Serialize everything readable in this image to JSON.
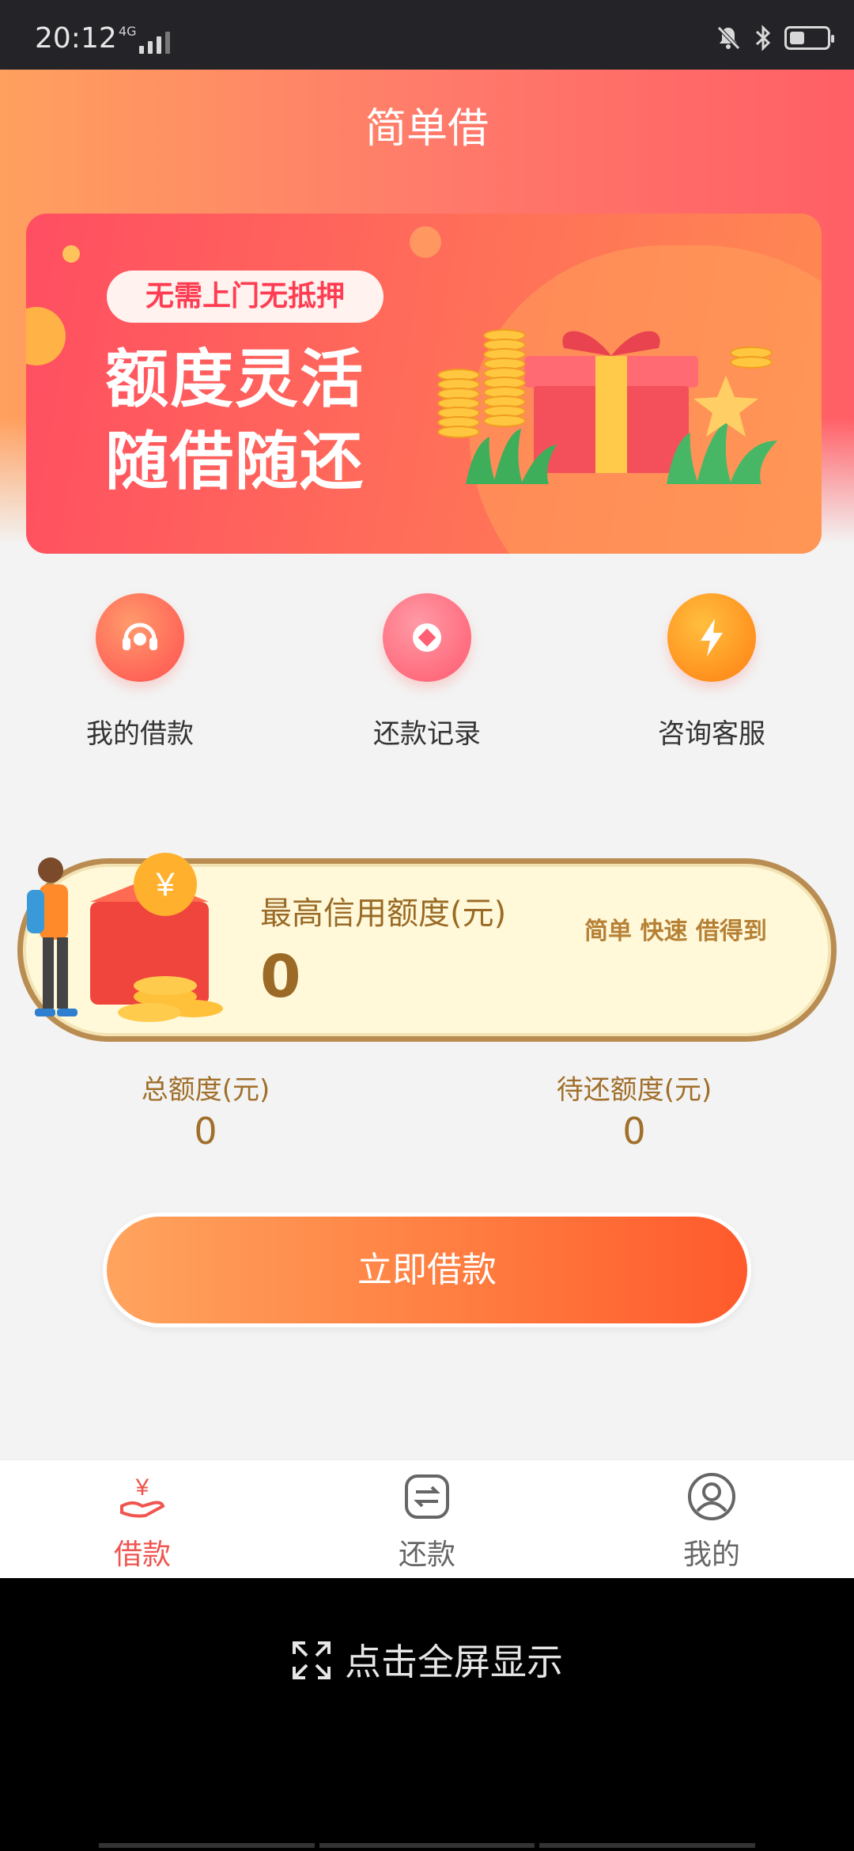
{
  "status_bar": {
    "time": "20:12",
    "network": "4G"
  },
  "header": {
    "title": "简单借"
  },
  "banner": {
    "tag": "无需上门无抵押",
    "headline_line1": "额度灵活",
    "headline_line2": "随借随还"
  },
  "quick_actions": [
    {
      "label": "我的借款",
      "icon": "headset-icon",
      "color": "#ff6a5a"
    },
    {
      "label": "还款记录",
      "icon": "diamond-icon",
      "color": "#ff6f7d"
    },
    {
      "label": "咨询客服",
      "icon": "lightning-icon",
      "color": "#ff9322"
    }
  ],
  "credit": {
    "title": "最高信用额度(元)",
    "value": "0",
    "slogan": "简单 快速 借得到"
  },
  "totals": {
    "total_label": "总额度(元)",
    "total_value": "0",
    "pending_label": "待还额度(元)",
    "pending_value": "0"
  },
  "borrow_button": {
    "label": "立即借款"
  },
  "tabbar": [
    {
      "label": "借款",
      "active": true
    },
    {
      "label": "还款",
      "active": false
    },
    {
      "label": "我的",
      "active": false
    }
  ],
  "fullscreen": {
    "label": "点击全屏显示"
  },
  "colors": {
    "accent": "#ff5f5a",
    "gold": "#9a6a26",
    "tab_active": "#f0554f",
    "tab_inactive": "#666666"
  }
}
